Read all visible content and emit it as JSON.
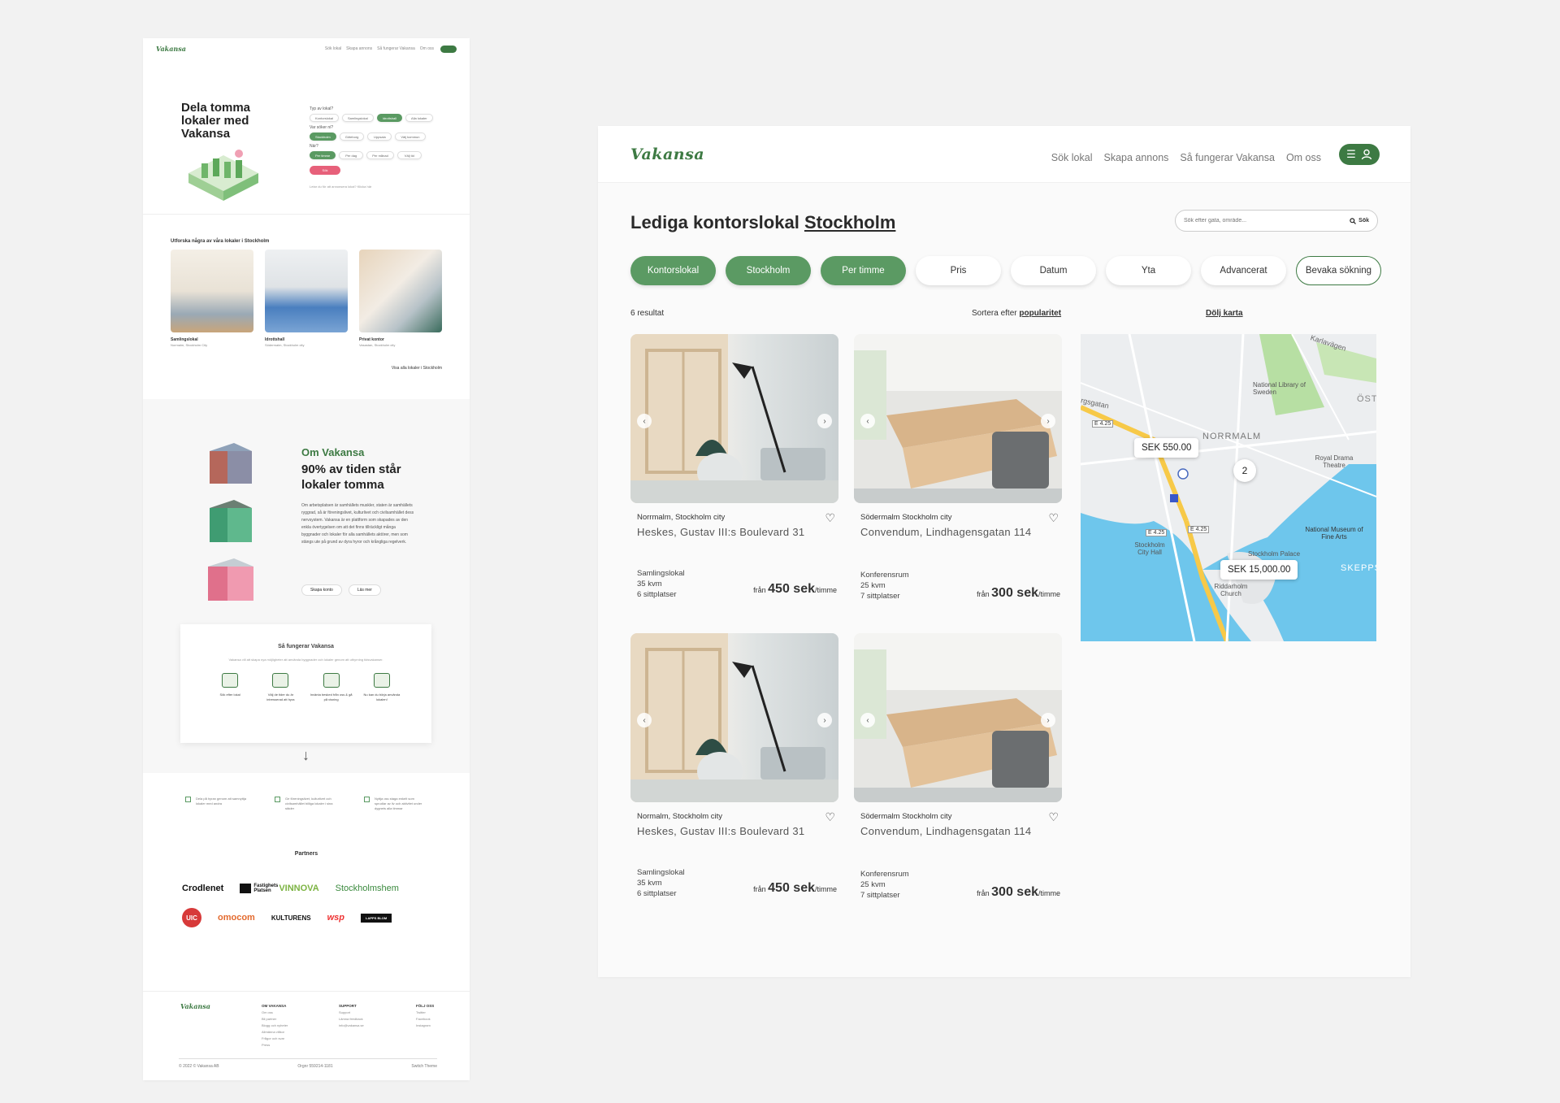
{
  "mini": {
    "logo": "Vakansa",
    "nav": [
      "Sök lokal",
      "Skapa annons",
      "Så fungerar Vakansa",
      "Om oss"
    ],
    "hero_title": "Dela tomma lokaler med Vakansa",
    "q1": "Typ av lokal?",
    "q1_opts": [
      "Kontorslokal",
      "Samlingslokal",
      "Idrottshall",
      "Alla lokaler"
    ],
    "q2": "Var söker ni?",
    "q2_opts": [
      "Stockholm",
      "Göteborg",
      "Uppsala",
      "Välj kommun"
    ],
    "q3": "När?",
    "q3_opts": [
      "Per timme",
      "Per dag",
      "Per månad",
      "Välj tid"
    ],
    "search_btn": "Sök",
    "small_note": "Letar du för att annonsera lokal? Klicka här",
    "explore_title": "Utforska några av våra lokaler i Stockholm",
    "explore_cards": [
      {
        "title": "Samlingslokal",
        "sub": "Normalm, Stockholm City"
      },
      {
        "title": "Idrottshall",
        "sub": "Södermalm, Stockholm city"
      },
      {
        "title": "Privat kontor",
        "sub": "Vasastan, Stockholm city"
      }
    ],
    "view_all": "Visa alla lokaler i Stockholm",
    "about_green": "Om Vakansa",
    "about_title": "90% av tiden står lokaler tomma",
    "about_text": "Om arbetsplatsen är samhällets muskler, staten är samhällets ryggrad, så är föreningslivet, kulturlivet och civilsamhället dess nervsystem. Vakansa är en plattform som skapades av den enkla övertygelsen om att det finns tillräckligt många byggnader och lokaler för alla samhällets aktörer, men som stängs ute på grund av dyra hyror och krångliga regelverk.",
    "btn_create": "Skapa konto",
    "btn_more": "Läs mer",
    "how_title": "Så fungerar Vakansa",
    "how_sub": "Vakansa vill att skapa nya möjligheter att använda byggnader och lokaler genom att uthyrning tidsvakanser.",
    "how_steps": [
      "Sök efter lokal",
      "Välj de tider du är intresserad att hyra",
      "Invänta besked från oss & gå på visning",
      "Nu kan du börja använda lokalen!"
    ],
    "arrow": "↓",
    "feats": [
      "Dela på hyran genom att samnyttja lokaler med andra",
      "Ge föreningslivet, kulturlivet och civilsamhället billiga lokaler i sina städer",
      "Nyttja oss staga enkelt som sprudlar av liv och aktivitet under dygnets alla timmar"
    ],
    "partners_title": "Partners",
    "partners": [
      "Crodlenet",
      "Fastighets Platsen",
      "VINNOVA",
      "Stockholmshem",
      "UIC",
      "omocom",
      "KULTURENS",
      "wsp",
      "LAPPS BLOM"
    ],
    "footer_cols": [
      {
        "head": "OM VAKANSA",
        "items": [
          "Om oss",
          "Bli partner",
          "Blogg och nyheter",
          "Allmänna villkor",
          "Frågor och svar",
          "Press"
        ]
      },
      {
        "head": "SUPPORT",
        "items": [
          "Support",
          "Lämna feedback",
          "info@vakansa.se"
        ]
      },
      {
        "head": "FÖLJ OSS",
        "items": [
          "Twitter",
          "Facebook",
          "Instagram"
        ]
      }
    ],
    "copy": "© 2022 © Vakansa AB",
    "orgnr": "Orgnr 559214-1181",
    "switch": "Switch Theme"
  },
  "main": {
    "logo": "Vakansa",
    "nav": [
      "Sök lokal",
      "Skapa annons",
      "Så fungerar Vakansa",
      "Om oss"
    ],
    "title_pre": "Lediga kontorslokal",
    "title_city": "Stockholm",
    "search_placeholder": "Sök efter gata, område...",
    "search_btn": "Sök",
    "filters": [
      "Kontorslokal",
      "Stockholm",
      "Per timme",
      "Pris",
      "Datum",
      "Yta",
      "Advancerat",
      "Bevaka sökning"
    ],
    "results": "6 resultat",
    "sort_pre": "Sortera efter",
    "sort_val": "popularitet",
    "hide_map": "Dölj karta",
    "listings": [
      {
        "loc": "Norrmalm, Stockholm city",
        "title": "Heskes,  Gustav III:s Boulevard 31",
        "type": "Samlingslokal",
        "size": "35 kvm",
        "seats": "6 sittplatser",
        "from": "från",
        "price": "450 sek",
        "unit": "/timme"
      },
      {
        "loc": "Södermalm Stockholm city",
        "title": "Convendum, Lindhagensgatan 114",
        "type": "Konferensrum",
        "size": "25 kvm",
        "seats": "7 sittplatser",
        "from": "från",
        "price": "300 sek",
        "unit": "/timme"
      },
      {
        "loc": "Normalm, Stockholm city",
        "title": "Heskes,  Gustav III:s Boulevard 31",
        "type": "Samlingslokal",
        "size": "35 kvm",
        "seats": "6 sittplatser",
        "from": "från",
        "price": "450 sek",
        "unit": "/timme"
      },
      {
        "loc": "Södermalm Stockholm city",
        "title": "Convendum, Lindhagensgatan 114",
        "type": "Konferensrum",
        "size": "25 kvm",
        "seats": "7 sittplatser",
        "from": "från",
        "price": "300 sek",
        "unit": "/timme"
      }
    ],
    "map": {
      "pin1": "SEK 550.00",
      "pin2": "SEK 15,000.00",
      "cluster": "2",
      "labels": [
        "Karlavägen",
        "National Library of Sweden",
        "NORRMALM",
        "Royal Drama Theatre",
        "National Museum of Fine Arts",
        "Stockholm Palace",
        "Stockholm City Hall",
        "Riddarholm Church",
        "SKEPPS",
        "ÖSTE",
        "rgsgatan",
        "E 4.25",
        "E 4.25",
        "E 4.25"
      ]
    }
  }
}
